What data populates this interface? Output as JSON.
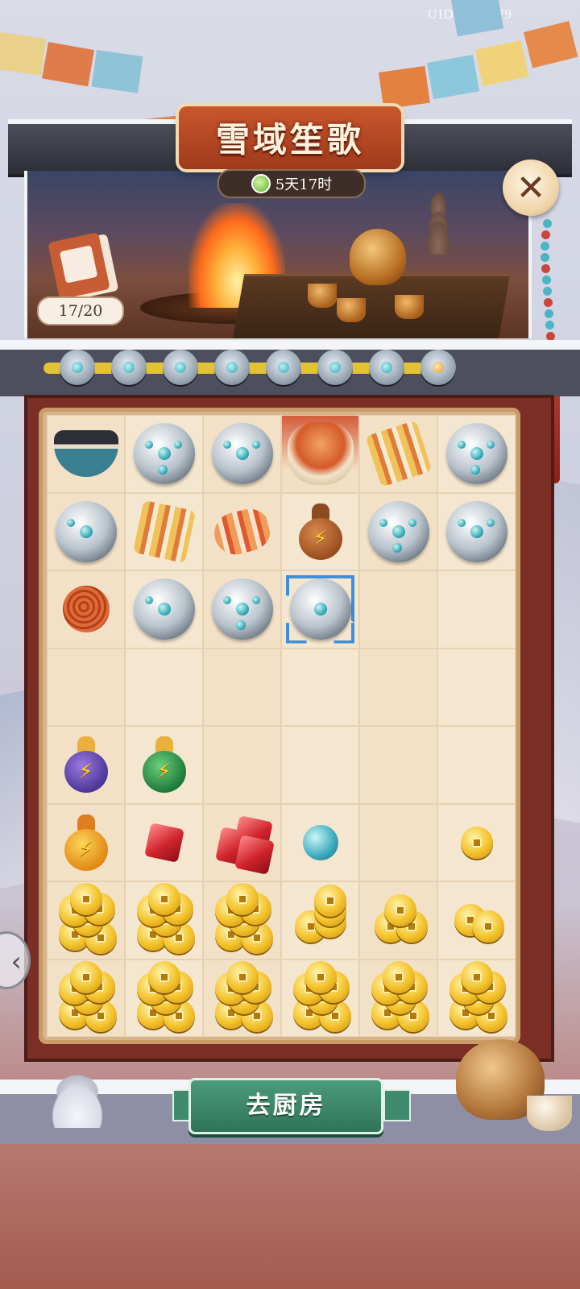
{
  "uid": "UID:2683179",
  "event": {
    "title": "雪域笙歌",
    "timer": "5天17时",
    "progress_count": "17/20",
    "progress_fraction": 0.94,
    "milestones": 8
  },
  "actions": {
    "go_kitchen": "去厨房"
  },
  "board": {
    "rows": [
      [
        "bowl",
        "silver-ornament",
        "silver-collar",
        "fur-hat",
        "striped-cloth",
        "silver-amulet"
      ],
      [
        "silver-hoop",
        "striped-scarf",
        "cloth-roll",
        "energy-gourd-brown",
        "turquoise-cluster",
        "silver-bracelet"
      ],
      [
        "yarn-ball",
        "turquoise-earrings",
        "turquoise-drops",
        "turquoise-pendant",
        "",
        ""
      ],
      [
        "",
        "",
        "",
        "",
        "",
        ""
      ],
      [
        "energy-gourd-purple",
        "energy-gourd-green",
        "",
        "",
        "",
        ""
      ],
      [
        "energy-gourd-gold",
        "ruby",
        "ruby-cluster",
        "turquoise-bead",
        "",
        "gold-coin"
      ],
      [
        "gold-coin-pile",
        "gold-coin-pile",
        "gold-coin-pile",
        "gold-coin-stack",
        "gold-coin-trio",
        "gold-coin-pair"
      ],
      [
        "gold-coin-pile",
        "gold-coin-pile",
        "gold-coin-pile",
        "gold-coin-pile",
        "gold-coin-pile",
        "gold-coin-pile"
      ]
    ],
    "selected_cell": [
      2,
      3
    ],
    "highlighted_cell": [
      0,
      3
    ]
  },
  "colors": {
    "accent_title": "#c9572c",
    "button_green": "#3f8a6c",
    "frame_red": "#7b2e25",
    "progress_yellow": "#e3c235"
  }
}
